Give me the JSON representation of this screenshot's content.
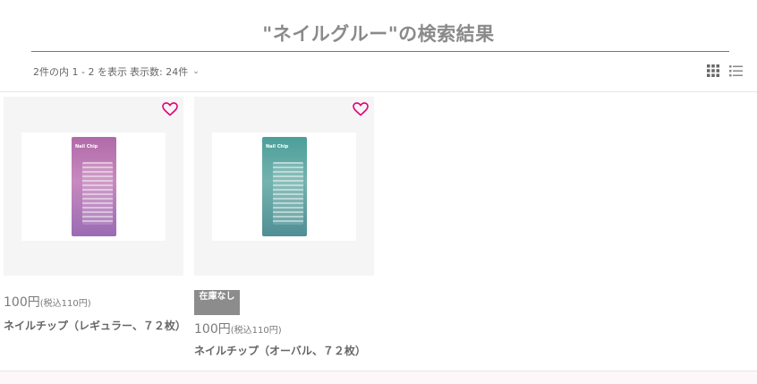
{
  "header": {
    "title": "\"ネイルグルー\"の検索結果"
  },
  "toolbar": {
    "count_text": "2件の内 1 - 2 を表示",
    "per_page_label": "表示数: 24件",
    "view_grid_icon": "grid-icon",
    "view_list_icon": "list-icon"
  },
  "colors": {
    "heart": "#e0007a",
    "badge": "#8c8c8c"
  },
  "products": [
    {
      "price": "100円",
      "price_tax": "(税込110円)",
      "name": "ネイルチップ（レギュラー、７２枚）",
      "pkg_label": "Nail Chip",
      "pkg_color": "pink",
      "badge": ""
    },
    {
      "price": "100円",
      "price_tax": "(税込110円)",
      "name": "ネイルチップ（オーバル、７２枚）",
      "pkg_label": "Nail Chip",
      "pkg_color": "teal",
      "badge": "在庫なし"
    }
  ]
}
